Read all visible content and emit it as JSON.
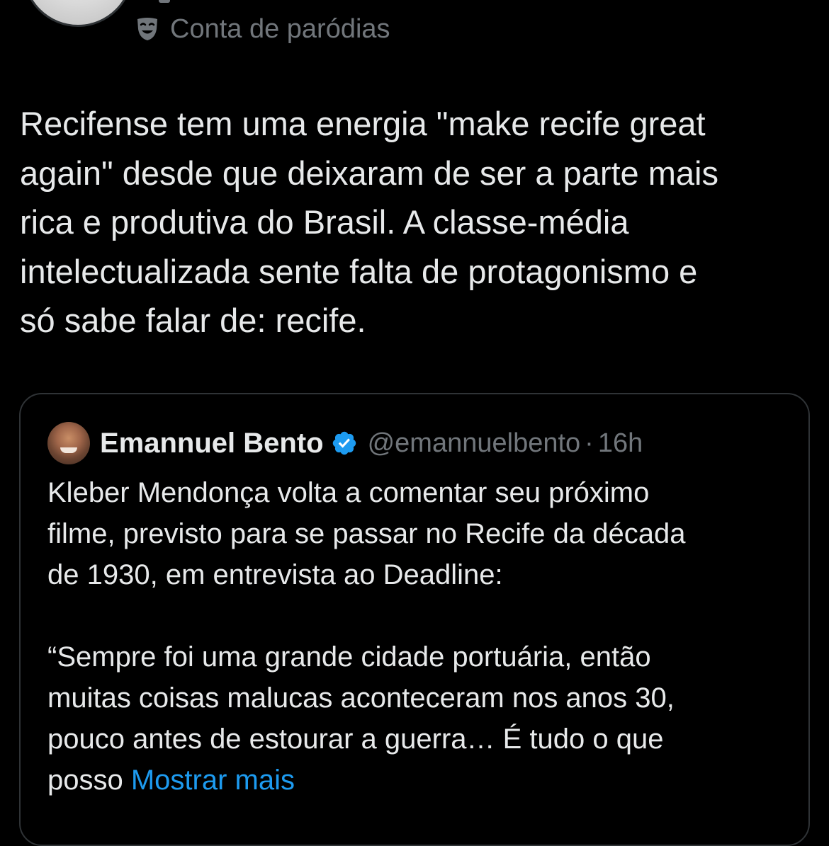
{
  "author": {
    "badge_label": "Conta de paródias"
  },
  "tweet": {
    "text": "Recifense tem uma energia \"make recife great\nagain\" desde que deixaram de ser a parte mais\nrica e produtiva do Brasil. A classe-média\nintelectualizada sente falta de protagonismo e\nsó sabe falar de: recife."
  },
  "quote": {
    "name": "Emannuel Bento",
    "handle": "@emannuelbento",
    "separator": "·",
    "time": "16h",
    "text": "Kleber Mendonça volta a comentar seu próximo\nfilme, previsto para se passar no Recife da década\nde 1930, em entrevista ao Deadline:",
    "text2": "“Sempre foi uma grande cidade portuária, então\nmuitas coisas malucas aconteceram nos anos 30,\npouco antes de estourar a guerra… É tudo o que\nposso ",
    "show_more": "Mostrar mais"
  },
  "colors": {
    "background": "#000000",
    "text": "#e7e9ea",
    "muted": "#71767b",
    "link": "#1d9bf0",
    "border": "#2f3336",
    "verified": "#1d9bf0"
  },
  "icons": {
    "parody": "theater-mask-icon",
    "verified": "verified-badge-icon"
  }
}
